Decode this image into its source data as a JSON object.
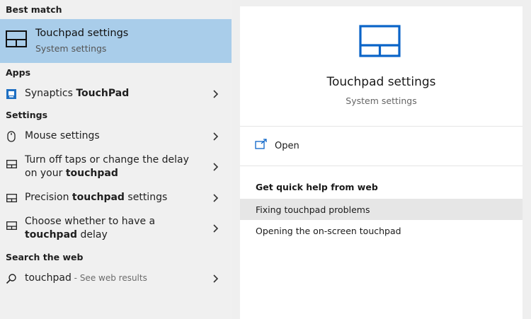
{
  "left": {
    "best_match_header": "Best match",
    "best": {
      "title": "Touchpad settings",
      "subtitle": "System settings",
      "icon": "touchpad-icon"
    },
    "apps_header": "Apps",
    "apps": [
      {
        "pre": "Synaptics ",
        "bold": "TouchPad",
        "post": "",
        "icon": "synaptics-app-icon"
      }
    ],
    "settings_header": "Settings",
    "settings": [
      {
        "pre": "Mouse settings",
        "bold": "",
        "post": "",
        "icon": "mouse-icon"
      },
      {
        "pre": "Turn off taps or change the delay on your ",
        "bold": "touchpad",
        "post": "",
        "icon": "touchpad-icon"
      },
      {
        "pre": "Precision ",
        "bold": "touchpad",
        "post": " settings",
        "icon": "touchpad-icon"
      },
      {
        "pre": "Choose whether to have a ",
        "bold": "touchpad",
        "post": " delay",
        "icon": "touchpad-icon"
      }
    ],
    "web_header": "Search the web",
    "web": {
      "query": "touchpad",
      "suffix": " - See web results",
      "icon": "search-icon"
    }
  },
  "right": {
    "title": "Touchpad settings",
    "subtitle": "System settings",
    "open_label": "Open",
    "help_title": "Get quick help from web",
    "help_items": [
      "Fixing touchpad problems",
      "Opening the on-screen touchpad"
    ]
  },
  "colors": {
    "selected": "#a9cdea",
    "accent": "#0a64c8"
  }
}
